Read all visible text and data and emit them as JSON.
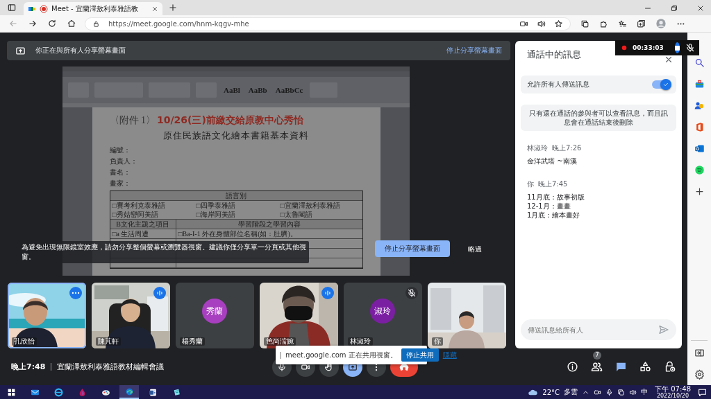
{
  "browser": {
    "tab_title": "Meet - 宜蘭澤敖利泰雅語教",
    "url": "https://meet.google.com/hnm-kqgv-mhe"
  },
  "share_banner": {
    "text": "你正在與所有人分享螢幕畫面",
    "action": "停止分享螢幕畫面"
  },
  "shared_document": {
    "styles": [
      "AaBl",
      "AaBb",
      "AaBbCc"
    ],
    "prefix": "〈附件 1〉",
    "deadline": "10/26(三)前繳交給原教中心秀怡",
    "heading": "原住民族語文化繪本書籍基本資料",
    "fields": [
      "編號：",
      "負責人：",
      "書名：",
      "畫家："
    ],
    "table": {
      "header": "語言別",
      "languages": [
        "□賽考利克泰雅語",
        "□四季泰雅語",
        "□宜蘭澤敖利泰雅語",
        "□秀姑巒阿美語",
        "□海岸阿美語",
        "□太魯閣語"
      ],
      "column_heads": [
        "B文化主題之項目",
        "學習階段之學習內容"
      ],
      "topic": "□a 生活周遭",
      "content": "□Ba-I-1 外在身體部位名稱(如：肚臍)。"
    }
  },
  "mirror_warning": {
    "text": "為避免出現無限鏡室效應，請勿分享整個螢幕或瀏覽器視窗。建議你僅分享單一分頁或其他視窗。",
    "stop_button": "停止分享螢幕畫面",
    "dismiss_button": "略過"
  },
  "participants": [
    {
      "name": "孔欣怡",
      "kind": "video",
      "selected": true,
      "speaking": false,
      "muted": false
    },
    {
      "name": "陳芃軒",
      "kind": "video",
      "selected": false,
      "speaking": true,
      "muted": false
    },
    {
      "name": "楊秀蘭",
      "kind": "avatar",
      "initials": "秀蘭",
      "color": "#a83fc0",
      "selected": false,
      "speaking": false,
      "muted": false
    },
    {
      "name": "笆尚澢婉",
      "kind": "video",
      "selected": false,
      "speaking": true,
      "muted": false
    },
    {
      "name": "林淑玲",
      "kind": "avatar",
      "initials": "淑玲",
      "color": "#7b1fa2",
      "selected": false,
      "speaking": false,
      "muted": true
    },
    {
      "name": "你",
      "kind": "video",
      "selected": false,
      "speaking": false,
      "muted": false
    }
  ],
  "meeting": {
    "time": "晚上7:48",
    "title": "宜蘭澤敖利泰雅語教材編輯會議"
  },
  "controls": [
    {
      "kind": "mic",
      "selected": false
    },
    {
      "kind": "camera",
      "selected": false
    },
    {
      "kind": "hand",
      "selected": false
    },
    {
      "kind": "present",
      "selected": true
    },
    {
      "kind": "more",
      "selected": false
    },
    {
      "kind": "end",
      "selected": false
    }
  ],
  "share_popup": {
    "text": "meet.google.com 正在共用視窗。",
    "stop_button": "停止共用",
    "hide_link": "隱藏"
  },
  "side_buttons": [
    {
      "kind": "info",
      "selected": false
    },
    {
      "kind": "people",
      "badge": "7",
      "selected": false
    },
    {
      "kind": "chat",
      "selected": true
    },
    {
      "kind": "activities",
      "selected": false
    },
    {
      "kind": "host",
      "selected": false
    }
  ],
  "chat": {
    "title": "通話中的訊息",
    "allow_label": "允許所有人傳送訊息",
    "allow_on": true,
    "notice": "只有還在通話的參與者可以查看訊息，而且訊息會在通話結束後刪除",
    "messages": [
      {
        "sender": "林淑玲",
        "time": "晚上7:26",
        "lines": [
          "金洋武塔 ~南溪"
        ]
      },
      {
        "sender": "你",
        "time": "晚上7:45",
        "lines": [
          "11月底：故事初版",
          "12-1月：畫畫",
          "1月底：繪本畫好"
        ]
      }
    ],
    "placeholder": "傳送訊息給所有人"
  },
  "recorder": {
    "elapsed": "00:33:03"
  },
  "taskbar": {
    "apps": [
      {
        "kind": "start",
        "selected": false
      },
      {
        "kind": "mail",
        "selected": false
      },
      {
        "kind": "ie",
        "selected": false
      },
      {
        "kind": "drop",
        "selected": false
      },
      {
        "kind": "paint",
        "selected": false
      },
      {
        "kind": "edge",
        "selected": true
      },
      {
        "kind": "word",
        "selected": false
      },
      {
        "kind": "notes",
        "selected": false
      }
    ],
    "temperature": "22°C",
    "weather": "多雲",
    "ime": "中",
    "time": "下午 07:48",
    "date": "2022/10/20"
  }
}
